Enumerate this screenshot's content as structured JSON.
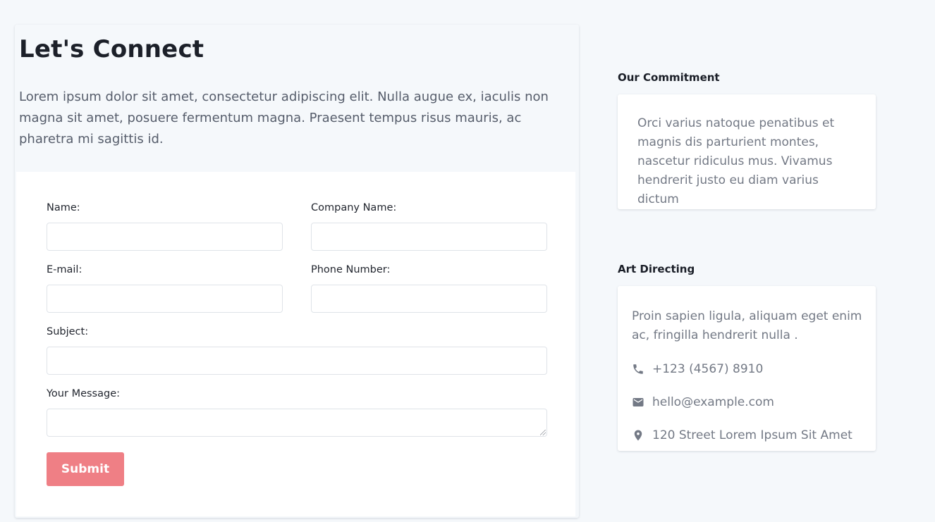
{
  "main": {
    "title": "Let's Connect",
    "intro": "Lorem ipsum dolor sit amet, consectetur adipiscing elit. Nulla augue ex, iaculis non magna sit amet, posuere fermentum magna. Praesent tempus risus mauris, ac pharetra mi sagittis id."
  },
  "form": {
    "name_label": "Name:",
    "name_value": "",
    "company_label": "Company Name:",
    "company_value": "",
    "email_label": "E-mail:",
    "email_value": "",
    "phone_label": "Phone Number:",
    "phone_value": "",
    "subject_label": "Subject:",
    "subject_value": "",
    "message_label": "Your Message:",
    "message_value": "",
    "submit_label": "Submit"
  },
  "sidebar": {
    "commitment": {
      "heading": "Our Commitment",
      "text": "Orci varius natoque penatibus et magnis dis parturient montes, nascetur ridiculus mus. Vivamus hendrerit justo eu diam varius dictum"
    },
    "art_directing": {
      "heading": "Art Directing",
      "text": "Proin sapien ligula, aliquam eget enim ac, fringilla hendrerit nulla .",
      "phone": "+123 (4567) 8910",
      "email": "hello@example.com",
      "address": "120 Street Lorem Ipsum Sit Amet"
    }
  },
  "icons": {
    "phone": "phone-icon",
    "email": "email-icon",
    "location": "location-pin-icon"
  },
  "colors": {
    "accent": "#ef7f85",
    "background": "#f5f8fb",
    "muted_text": "#737985"
  }
}
